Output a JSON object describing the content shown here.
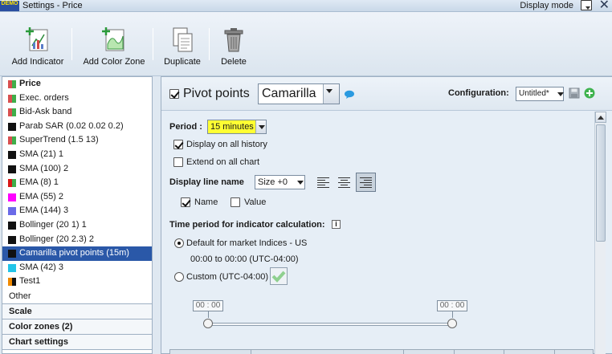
{
  "window": {
    "logo_text": "DEMO",
    "title": "Settings - Price",
    "display_mode_label": "Display mode"
  },
  "toolbar": {
    "add_indicator": "Add Indicator",
    "add_color_zone": "Add Color Zone",
    "duplicate": "Duplicate",
    "delete": "Delete"
  },
  "indicators": [
    {
      "label": "Price",
      "color": "#d85050",
      "color2": "#3fae4a",
      "bold": true
    },
    {
      "label": "Exec. orders",
      "color": "#d85050",
      "color2": "#3fae4a"
    },
    {
      "label": "Bid-Ask band",
      "color": "#d85050",
      "color2": "#3fae4a"
    },
    {
      "label": "Parab SAR (0.02 0.02 0.2)",
      "color": "#111111"
    },
    {
      "label": "SuperTrend (1.5 13)",
      "color": "#d85050",
      "color2": "#3fae4a"
    },
    {
      "label": "SMA (21) 1",
      "color": "#111111"
    },
    {
      "label": "SMA (100) 2",
      "color": "#111111"
    },
    {
      "label": "EMA (8) 1",
      "color": "#d81818",
      "color2": "#3fae4a"
    },
    {
      "label": "EMA (55) 2",
      "color": "#ff00ff"
    },
    {
      "label": "EMA (144) 3",
      "color": "#6a6ae8"
    },
    {
      "label": "Bollinger (20 1) 1",
      "color": "#111111"
    },
    {
      "label": "Bollinger (20 2.3) 2",
      "color": "#111111"
    },
    {
      "label": "Camarilla pivot points (15m)",
      "color": "#111111",
      "active": true
    },
    {
      "label": "SMA (42) 3",
      "color": "#22c4e8"
    },
    {
      "label": "Test1",
      "color": "#f08a00",
      "color2": "#111111"
    }
  ],
  "other_label": "Other",
  "sections": [
    "Scale",
    "Color zones (2)",
    "Chart settings"
  ],
  "header": {
    "indicator_name": "Pivot points",
    "type_value": "Camarilla",
    "configuration_label": "Configuration:",
    "configuration_value": "Untitled*"
  },
  "form": {
    "period_label": "Period :",
    "period_value": "15 minutes",
    "display_all_history": "Display on all history",
    "extend_all_chart": "Extend on all chart",
    "display_line_name": "Display line name",
    "size_value": "Size +0",
    "name_label": "Name",
    "value_label": "Value",
    "time_period_title": "Time period for indicator calculation:",
    "default_option": "Default for market Indices - US",
    "default_time": "00:00 to 00:00 (UTC-04:00)",
    "custom_option": "Custom (UTC-04:00)",
    "time_start": "00 : 00",
    "time_end": "00 : 00"
  },
  "colors": {
    "selection": "#2a58a8",
    "period_highlight": "#ffff33",
    "ok_green": "#3fb34f"
  }
}
